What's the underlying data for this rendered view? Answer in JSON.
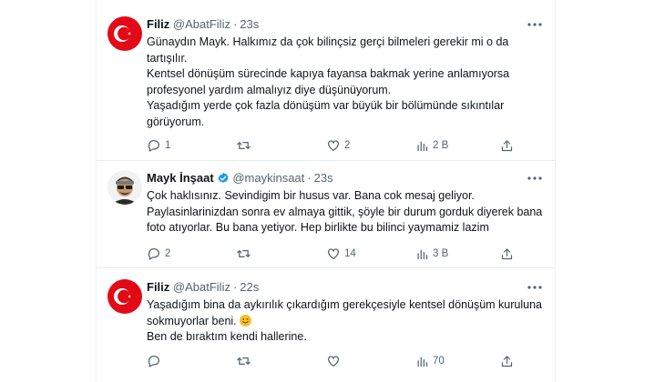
{
  "tweets": [
    {
      "name": "Filiz",
      "handle": "@AbatFiliz",
      "time": "23s",
      "verified": false,
      "lines": [
        "Günaydın Mayk. Halkımız da çok bilinçsiz gerçi bilmeleri gerekir mi o da tartışılır.",
        "Kentsel dönüşüm sürecinde kapıya fayansa bakmak yerine anlamıyorsa profesyonel yardım almalıyız diye düşünüyorum.",
        "Yaşadığım yerde çok fazla dönüşüm var büyük bir bölümünde sıkıntılar görüyorum."
      ],
      "stats": {
        "replies": "1",
        "retweets": "",
        "likes": "2",
        "views": "2 B"
      }
    },
    {
      "name": "Mayk İnşaat",
      "handle": "@maykinsaat",
      "time": "23s",
      "verified": true,
      "lines": [
        "Çok haklısınız. Sevindigim bir husus var. Bana cok mesaj geliyor. Paylasinlarinizdan sonra ev almaya gittik, şöyle bir durum gorduk diyerek bana foto atıyorlar. Bu bana yetiyor. Hep birlikte bu bilinci yaymamiz lazim"
      ],
      "stats": {
        "replies": "2",
        "retweets": "",
        "likes": "14",
        "views": "3 B"
      }
    },
    {
      "name": "Filiz",
      "handle": "@AbatFiliz",
      "time": "22s",
      "verified": false,
      "lines": [
        "Yaşadığım bina da aykırılık çıkardığım gerekçesiyle kentsel dönüşüm kuruluna sokmuyorlar beni.",
        "Ben de bıraktım kendi hallerine."
      ],
      "stats": {
        "replies": "",
        "retweets": "",
        "likes": "",
        "views": "70"
      }
    }
  ],
  "colors": {
    "text": "#0f1419",
    "muted": "#536471",
    "verified": "#1d9bf0",
    "divider": "#e7ecef",
    "flag_red": "#e30a17"
  },
  "icons": [
    "more-icon",
    "reply-icon",
    "retweet-icon",
    "like-icon",
    "views-icon",
    "share-icon",
    "verified-badge-icon",
    "smiling-face-emoji"
  ]
}
